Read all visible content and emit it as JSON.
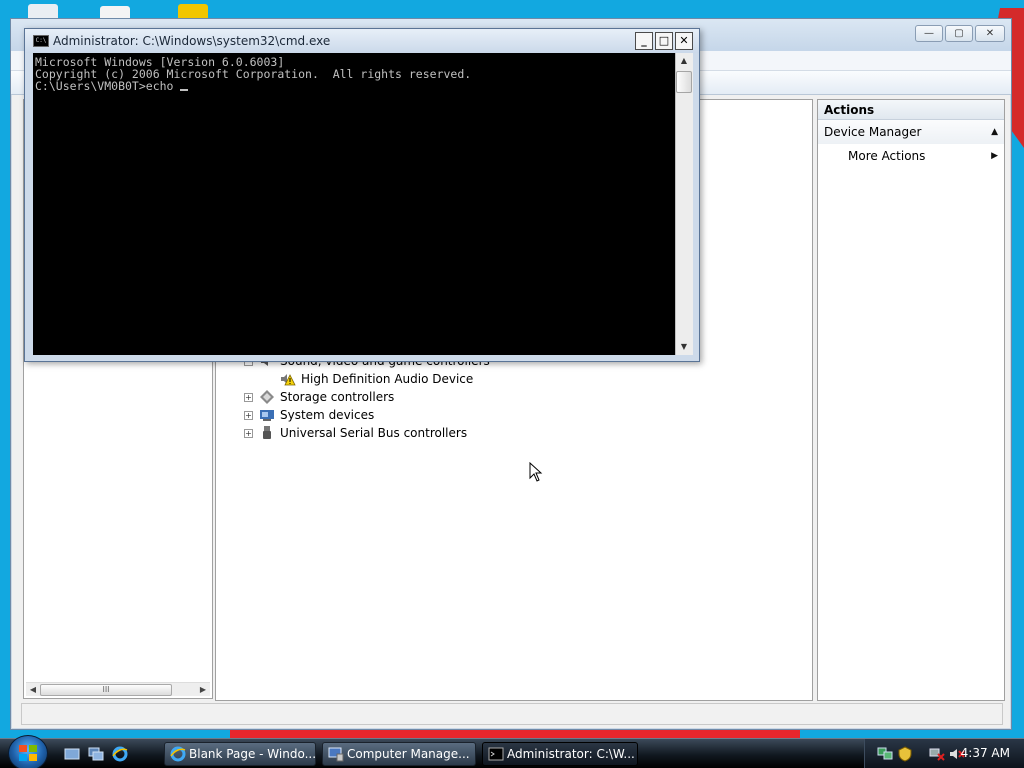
{
  "cmd": {
    "title": "Administrator: C:\\Windows\\system32\\cmd.exe",
    "icon_label": "C:\\",
    "controls": {
      "minimize": "_",
      "maximize": "□",
      "close": "✕"
    },
    "lines": [
      "Microsoft Windows [Version 6.0.6003]",
      "Copyright (c) 2006 Microsoft Corporation.  All rights reserved.",
      "",
      "C:\\Users\\VM0B0T>echo "
    ]
  },
  "computer_management": {
    "controls": {
      "minimize": "—",
      "maximize": "▢",
      "close": "✕"
    },
    "actions": {
      "header": "Actions",
      "group": "Device Manager",
      "items": [
        "More Actions"
      ]
    },
    "tree": [
      {
        "label": "Sound, video and game controllers",
        "expander": "−",
        "icon": "speaker-icon"
      },
      {
        "label": "High Definition Audio Device",
        "expander": "",
        "icon": "warning-audio-device-icon"
      },
      {
        "label": "Storage controllers",
        "expander": "+",
        "icon": "storage-controller-icon"
      },
      {
        "label": "System devices",
        "expander": "+",
        "icon": "system-devices-icon"
      },
      {
        "label": "Universal Serial Bus controllers",
        "expander": "+",
        "icon": "usb-icon"
      }
    ],
    "scroll_grip": "III"
  },
  "taskbar": {
    "buttons": [
      {
        "label": "Blank Page - Windo...",
        "icon": "ie-icon"
      },
      {
        "label": "Computer Manage...",
        "icon": "computer-management-icon"
      },
      {
        "label": "Administrator: C:\\W...",
        "icon": "cmd-icon"
      }
    ],
    "quick_launch": [
      "show-desktop-icon",
      "switch-windows-icon",
      "ie-icon"
    ],
    "tray_icons": [
      "network-icon",
      "security-icon",
      "network-disconnected-icon",
      "volume-muted-icon"
    ],
    "clock": "4:37 AM"
  },
  "colors": {
    "desktop": "#12a8e0",
    "console_bg": "#000000",
    "console_fg": "#c0c0c0"
  }
}
